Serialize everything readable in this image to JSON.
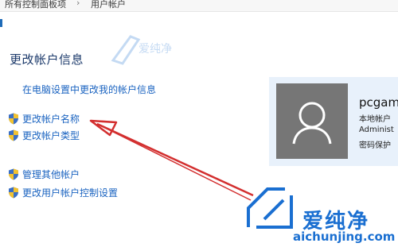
{
  "breadcrumb": {
    "items": [
      "所有控制面板项",
      "用户帐户"
    ],
    "separator": "›"
  },
  "page": {
    "title": "更改帐户信息",
    "pc_settings_link": "在电脑设置中更改我的帐户信息"
  },
  "tasks": {
    "change_name": "更改帐户名称",
    "change_type": "更改帐户类型",
    "manage_other": "管理其他帐户",
    "uac_settings": "更改用户帐户控制设置"
  },
  "user": {
    "name": "pcgam",
    "account_kind": "本地帐户",
    "role": "Administ",
    "password": "密码保护"
  },
  "watermark": {
    "brand_cn": "爱纯净",
    "brand_en": "aichunjing.com"
  },
  "colors": {
    "link": "#1a63c0",
    "title": "#1c3a6b",
    "card_bg": "#e8f1fb",
    "avatar_bg": "#767676",
    "arrow": "#d32f2f",
    "watermark": "#1a6fd1"
  },
  "icons": [
    "shield-icon",
    "user-avatar-icon",
    "arrow-annotation",
    "brand-logo-icon"
  ]
}
